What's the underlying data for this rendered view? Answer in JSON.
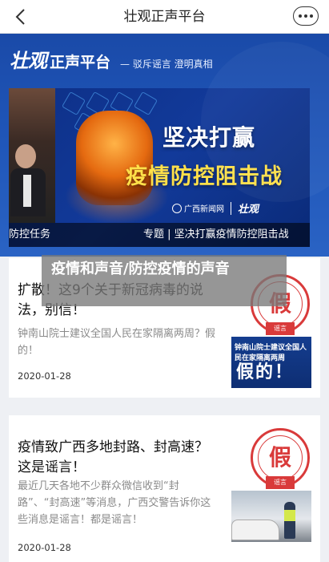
{
  "nav": {
    "title": "壮观正声平台",
    "back_icon": "chevron-left-icon",
    "more_icon": "more-dots-icon"
  },
  "header": {
    "logo": "壮观",
    "name": "正声平台",
    "slogan": "— 驳斥谣言  澄明真相"
  },
  "banner": {
    "headline_line1": "坚决打赢",
    "headline_line2": "疫情防控阻击战",
    "source_logo": "广西新闻网",
    "partner_logo": "壮观",
    "caption_left": "防控任务",
    "caption_right": "专题 | 坚决打赢疫情防控阻击战"
  },
  "section": {
    "title": "疫情和声音/防控疫情的声音"
  },
  "articles": [
    {
      "title": "扩散！这9个关于新冠病毒的说法，别信！",
      "summary": "钟南山院士建议全国人民在家隔离两周？假的！",
      "date": "2020-01-28",
      "stamp": "假",
      "stamp_tag": "谣言",
      "thumb_line1": "钟南山院士建议全国人民在家隔离两周",
      "thumb_line2": "假的！"
    },
    {
      "title": "疫情致广西多地封路、封高速？这是谣言！",
      "summary": "最近几天各地不少群众微信收到“封路”、“封高速”等消息，广西交警告诉你这些消息是谣言！都是谣言！",
      "date": "2020-01-28",
      "stamp": "假",
      "stamp_tag": "谣言"
    }
  ],
  "colors": {
    "header_blue": "#1f55b8",
    "headline_yellow": "#ffe04a",
    "stamp_red": "#d93a3a"
  }
}
